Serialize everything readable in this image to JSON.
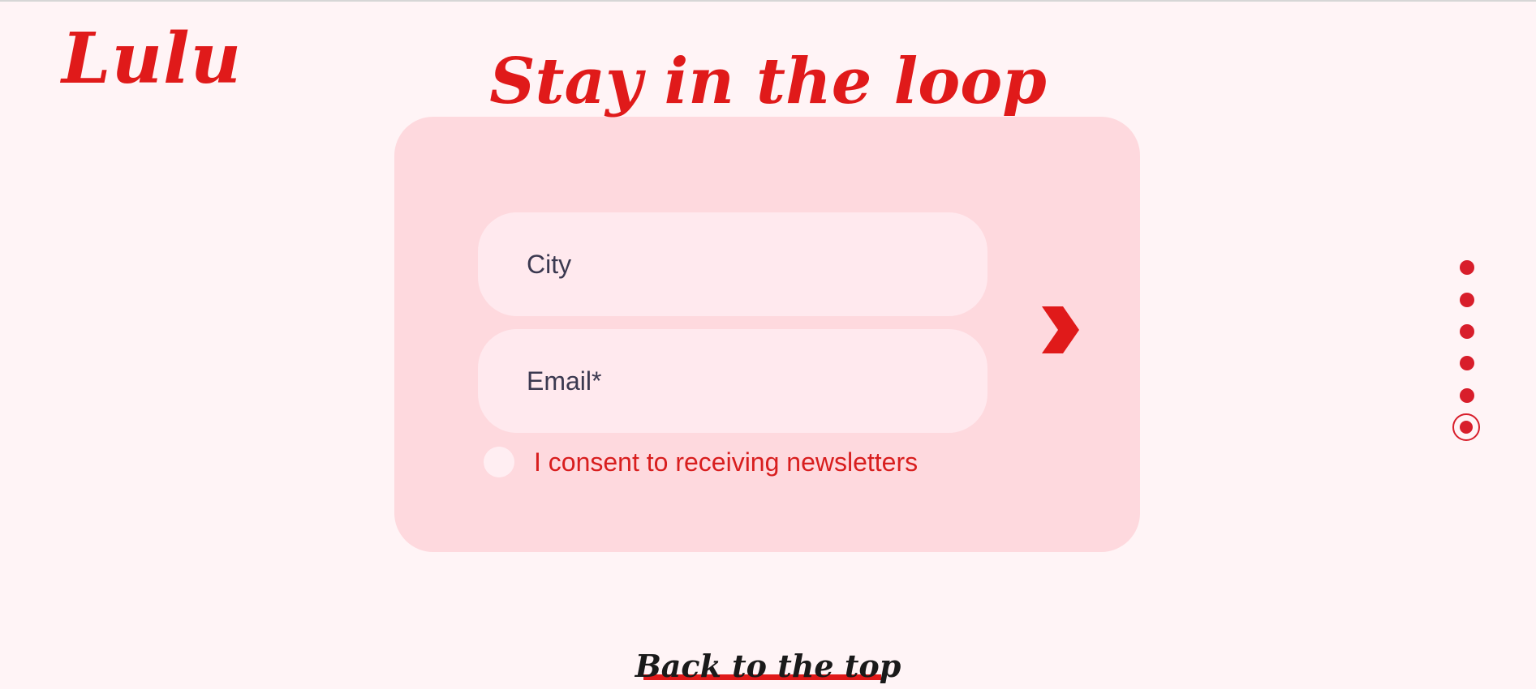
{
  "brand": {
    "logo_text": "Lulu",
    "accent_color": "#e01a1a"
  },
  "newsletter": {
    "title": "Stay in the loop",
    "city_placeholder": "City",
    "email_placeholder": "Email*",
    "consent_label": "I consent to receiving newsletters",
    "submit_icon": "chevron-right-icon"
  },
  "section_nav": {
    "dots_count": 6,
    "active_index": 5
  },
  "footer": {
    "back_to_top": "Back to the top"
  },
  "colors": {
    "page_background": "#fff4f6",
    "card_background": "#fed9de",
    "field_background": "#ffe9ee",
    "dot_color": "#d81e2b",
    "text_dark": "#3b3950"
  }
}
